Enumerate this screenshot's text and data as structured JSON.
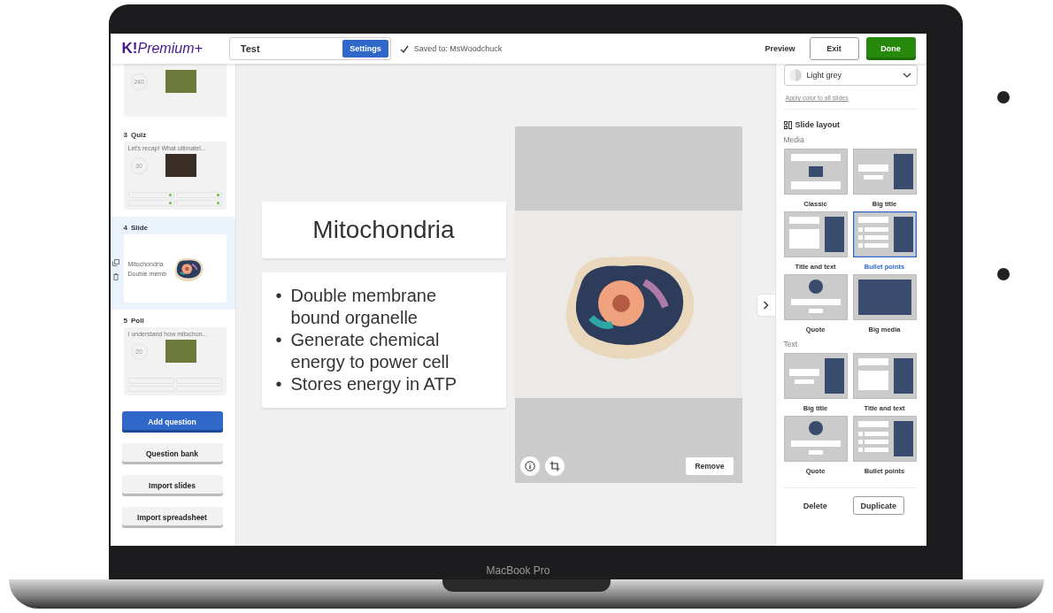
{
  "header": {
    "logo": {
      "mark": "K!",
      "text": "Premium+"
    },
    "title_field": {
      "value": "Test"
    },
    "settings_button": "Settings",
    "saved_status": "Saved to: MsWoodchuck",
    "actions": [
      {
        "label": "Preview",
        "kind": "text"
      },
      {
        "label": "Exit",
        "kind": "outline"
      },
      {
        "label": "Done",
        "kind": "primary"
      }
    ]
  },
  "sidebar": {
    "slides": [
      {
        "kind": "question",
        "time": "240",
        "selected": false
      },
      {
        "kind": "question",
        "number": "3",
        "type": "Quiz",
        "question": "Let's recap! What ultimatel...",
        "time": "30",
        "selected": false,
        "answer_marks": [
          true,
          true,
          true,
          true
        ]
      },
      {
        "kind": "content",
        "number": "4",
        "type": "Slide",
        "lines": [
          "Mitochondria",
          "Double memb"
        ],
        "selected": true
      },
      {
        "kind": "question",
        "number": "5",
        "type": "Poll",
        "question": "I understand how mitochon...",
        "time": "20",
        "selected": false,
        "answer_marks": [
          false,
          false,
          false,
          false
        ]
      }
    ],
    "buttons": [
      {
        "label": "Add question",
        "kind": "primary"
      },
      {
        "label": "Question bank",
        "kind": "secondary"
      },
      {
        "label": "Import slides",
        "kind": "secondary"
      },
      {
        "label": "Import spreadsheet",
        "kind": "secondary"
      }
    ]
  },
  "canvas": {
    "title": "Mitochondria",
    "bullets": [
      {
        "marker": "•",
        "text": "Double membrane bound organelle"
      },
      {
        "marker": "•",
        "text": "Generate chemical energy to power cell"
      },
      {
        "marker": "•",
        "text": "Stores energy in ATP"
      }
    ],
    "media": {
      "remove_button": "Remove"
    }
  },
  "panel": {
    "background_select": {
      "value": "Light grey"
    },
    "apply_link": "Apply color to all slides",
    "section_title": "Slide layout",
    "groups": [
      {
        "label": "Media",
        "layouts": [
          {
            "label": "Classic",
            "kind": "classic",
            "selected": false
          },
          {
            "label": "Big title",
            "kind": "big-title",
            "selected": false
          },
          {
            "label": "Title and text",
            "kind": "title-text",
            "selected": false
          },
          {
            "label": "Bullet points",
            "kind": "bullets",
            "selected": true
          },
          {
            "label": "Quote",
            "kind": "quote",
            "selected": false
          },
          {
            "label": "Big media",
            "kind": "big-media",
            "selected": false
          }
        ]
      },
      {
        "label": "Text",
        "layouts": [
          {
            "label": "Big title",
            "kind": "big-title",
            "selected": false
          },
          {
            "label": "Title and text",
            "kind": "title-text",
            "selected": false
          },
          {
            "label": "Quote",
            "kind": "quote",
            "selected": false
          },
          {
            "label": "Bullet points",
            "kind": "bullets",
            "selected": false
          }
        ]
      }
    ],
    "footer": [
      {
        "label": "Delete",
        "kind": "text"
      },
      {
        "label": "Duplicate",
        "kind": "outline"
      }
    ]
  },
  "device": {
    "label": "MacBook Pro"
  }
}
